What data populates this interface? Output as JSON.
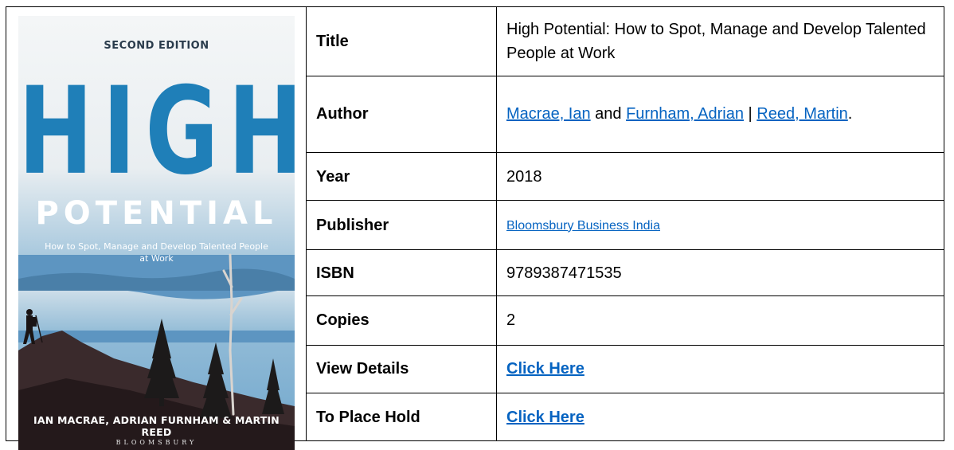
{
  "cover": {
    "edition": "SECOND EDITION",
    "title_main": "HIGH",
    "title_sub": "POTENTIAL",
    "tagline": "How to Spot, Manage and Develop Talented People at Work",
    "authors": "IAN MACRAE, ADRIAN FURNHAM & MARTIN REED",
    "imprint": "BLOOMSBURY"
  },
  "rows": {
    "title": {
      "label": "Title",
      "value": "High Potential: How to Spot, Manage and Develop Talented People at Work"
    },
    "author": {
      "label": "Author",
      "author1": "Macrae, Ian",
      "and": " and ",
      "author2": "Furnham, Adrian",
      "sep": " | ",
      "author3": "Reed, Martin",
      "end": "."
    },
    "year": {
      "label": "Year",
      "value": "2018"
    },
    "publisher": {
      "label": "Publisher",
      "value": "Bloomsbury Business India"
    },
    "isbn": {
      "label": "ISBN",
      "value": "9789387471535"
    },
    "copies": {
      "label": "Copies",
      "value": "2"
    },
    "view_details": {
      "label": "View Details",
      "link": "Click Here"
    },
    "place_hold": {
      "label": "To Place Hold",
      "link": "Click Here"
    }
  },
  "colors": {
    "link": "#0563c1",
    "cover_title": "#1f7fb8"
  }
}
